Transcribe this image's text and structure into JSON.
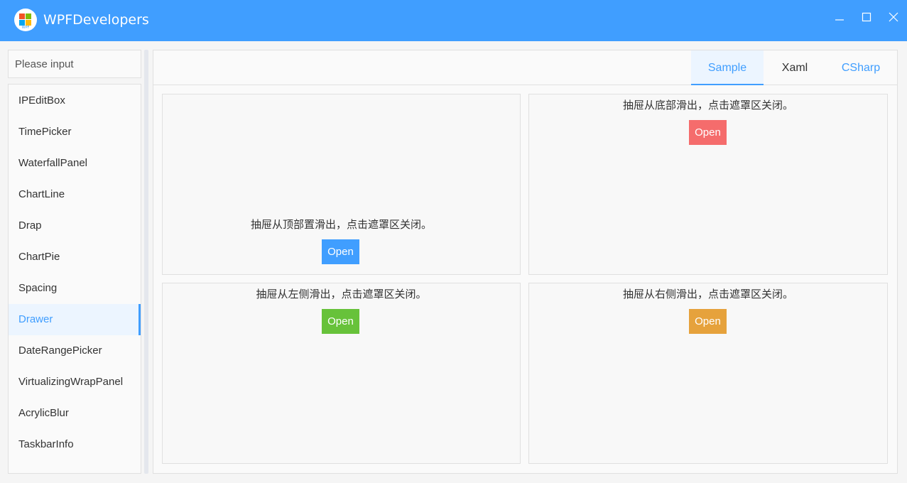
{
  "app": {
    "title": "WPFDevelopers",
    "logo_text": "WPF"
  },
  "window_controls": {
    "minimize_icon": "minimize-icon",
    "maximize_icon": "maximize-icon",
    "close_icon": "close-icon"
  },
  "search": {
    "placeholder": "Please input",
    "value": ""
  },
  "sidebar": {
    "items": [
      {
        "label": "IPEditBox"
      },
      {
        "label": "TimePicker"
      },
      {
        "label": "WaterfallPanel"
      },
      {
        "label": "ChartLine"
      },
      {
        "label": "Drap"
      },
      {
        "label": "ChartPie"
      },
      {
        "label": "Spacing"
      },
      {
        "label": "Drawer"
      },
      {
        "label": "DateRangePicker"
      },
      {
        "label": "VirtualizingWrapPanel"
      },
      {
        "label": "AcrylicBlur"
      },
      {
        "label": "TaskbarInfo"
      },
      {
        "label": ""
      }
    ],
    "selected": "Drawer"
  },
  "tabs": {
    "sample": "Sample",
    "xaml": "Xaml",
    "csharp": "CSharp",
    "active": "Sample"
  },
  "cards": {
    "top": {
      "text": "抽屉从顶部置滑出，点击遮罩区关闭。",
      "button": "Open",
      "color": "#409eff"
    },
    "bottom": {
      "text": "抽屉从底部滑出，点击遮罩区关闭。",
      "button": "Open",
      "color": "#f56c6c"
    },
    "left": {
      "text": "抽屉从左侧滑出，点击遮罩区关闭。",
      "button": "Open",
      "color": "#67c23a"
    },
    "right": {
      "text": "抽屉从右侧滑出，点击遮罩区关闭。",
      "button": "Open",
      "color": "#e6a23c"
    }
  },
  "colors": {
    "accent": "#409eff",
    "titlebar": "#409eff"
  }
}
